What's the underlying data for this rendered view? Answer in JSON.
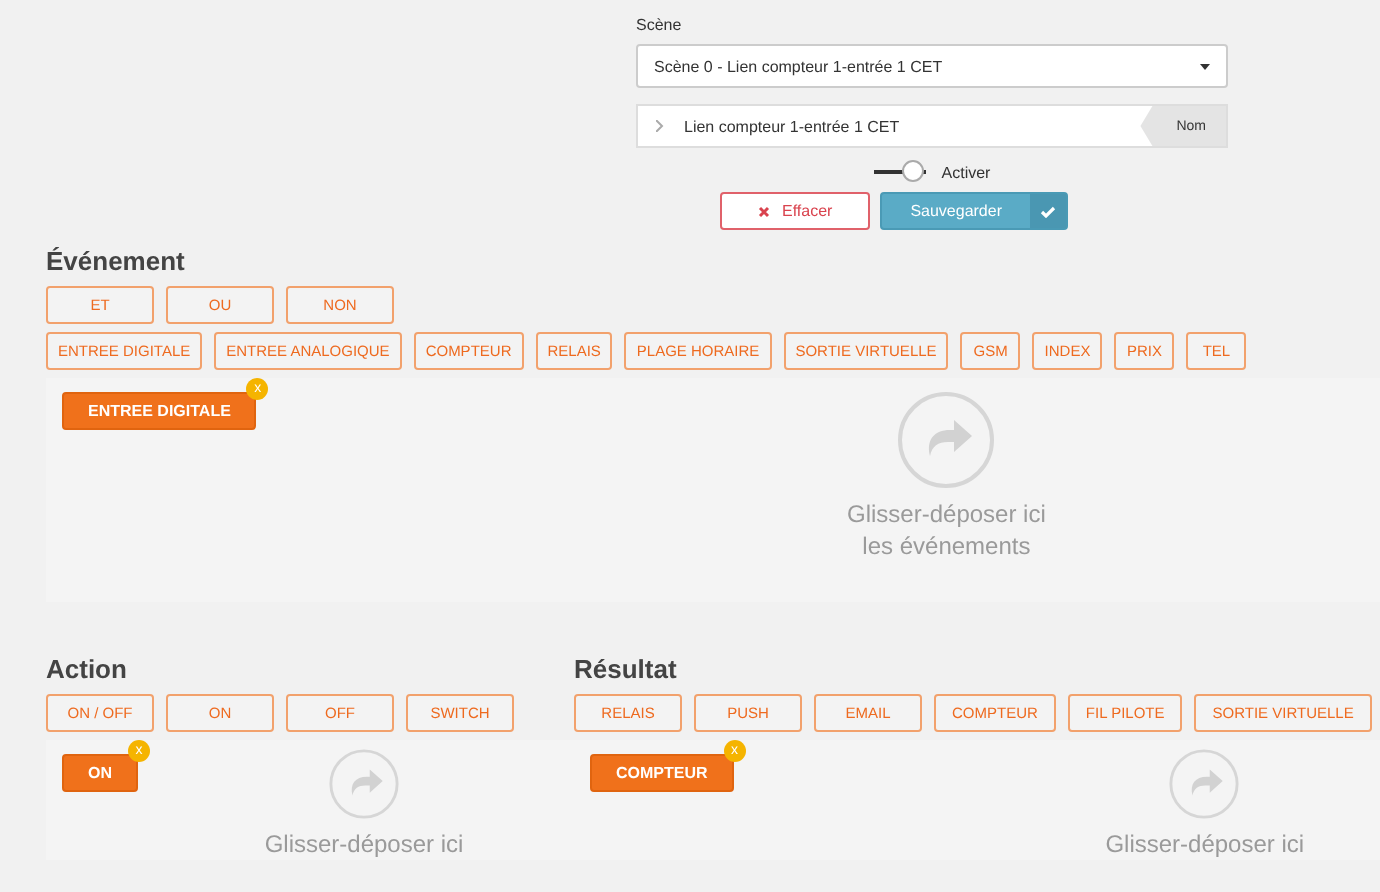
{
  "scene": {
    "label": "Scène",
    "value": "Scène 0 - Lien compteur 1-entrée 1 CET"
  },
  "name_field": {
    "value": "Lien compteur 1-entrée 1 CET",
    "tag": "Nom"
  },
  "toggle": {
    "label": "Activer",
    "on": false
  },
  "buttons": [
    {
      "label": "Effacer",
      "kind": "danger"
    },
    {
      "label": "Sauvegarder",
      "kind": "primary"
    }
  ],
  "event": {
    "title": "Événement",
    "operators": [
      "ET",
      "OU",
      "NON"
    ],
    "rows": [
      [
        "ENTREE DIGITALE",
        "ENTREE ANALOGIQUE",
        "COMPTEUR",
        "RELAIS",
        "PLAGE HORAIRE",
        "SORTIE VIRTUELLE",
        "GSM",
        "INDEX",
        "PRIX",
        "TEL"
      ]
    ],
    "dropped": [
      {
        "label": "ENTREE DIGITALE",
        "remove": "x"
      }
    ],
    "hint": [
      "Glisser-déposer ici",
      "les événements"
    ]
  },
  "action": {
    "title": "Action",
    "rows": [
      [
        "ON / OFF",
        "ON",
        "OFF",
        "SWITCH"
      ]
    ],
    "dropped": [
      {
        "label": "ON",
        "remove": "x"
      }
    ],
    "hint": [
      "Glisser-déposer ici"
    ]
  },
  "result": {
    "title": "Résultat",
    "rows": [
      [
        "RELAIS",
        "PUSH",
        "EMAIL",
        "COMPTEUR",
        "FIL PILOTE",
        "SORTIE VIRTUELLE"
      ]
    ],
    "dropped": [
      {
        "label": "COMPTEUR",
        "remove": "x"
      }
    ],
    "hint": [
      "Glisser-déposer ici"
    ]
  }
}
